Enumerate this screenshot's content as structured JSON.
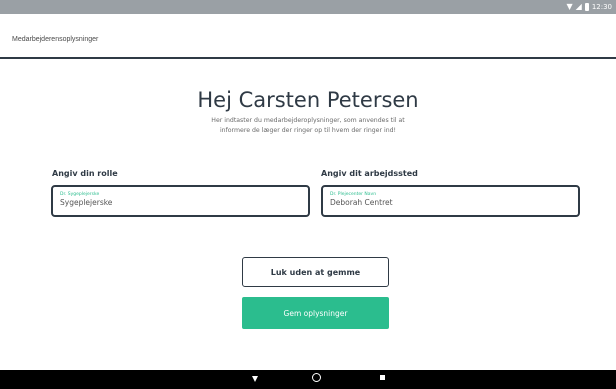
{
  "status_bar": {
    "icons": [
      "wifi-icon",
      "signal-icon",
      "battery-icon"
    ],
    "time": "12:30"
  },
  "app_bar": {
    "title": "Medarbejderensoplysninger"
  },
  "header": {
    "greeting": "Hej Carsten Petersen",
    "subtitle_line1": "Her indtaster du medarbejderoplysninger, som anvendes til at",
    "subtitle_line2": "informere de læger der ringer op til hvem der ringer ind!"
  },
  "role": {
    "label": "Angiv din rolle",
    "float_label": "Dr. Sygeplejerske",
    "value": "Sygeplejerske"
  },
  "workplace": {
    "label": "Angiv dit arbejdssted",
    "float_label": "Dr. Plejecenter Navn",
    "value": "Deborah Centret"
  },
  "buttons": {
    "close_label": "Luk uden at gemme",
    "save_label": "Gem oplysninger"
  },
  "colors": {
    "accent": "#2bbd8e",
    "dark": "#2f3a45",
    "status_bar": "#9aa0a5"
  }
}
